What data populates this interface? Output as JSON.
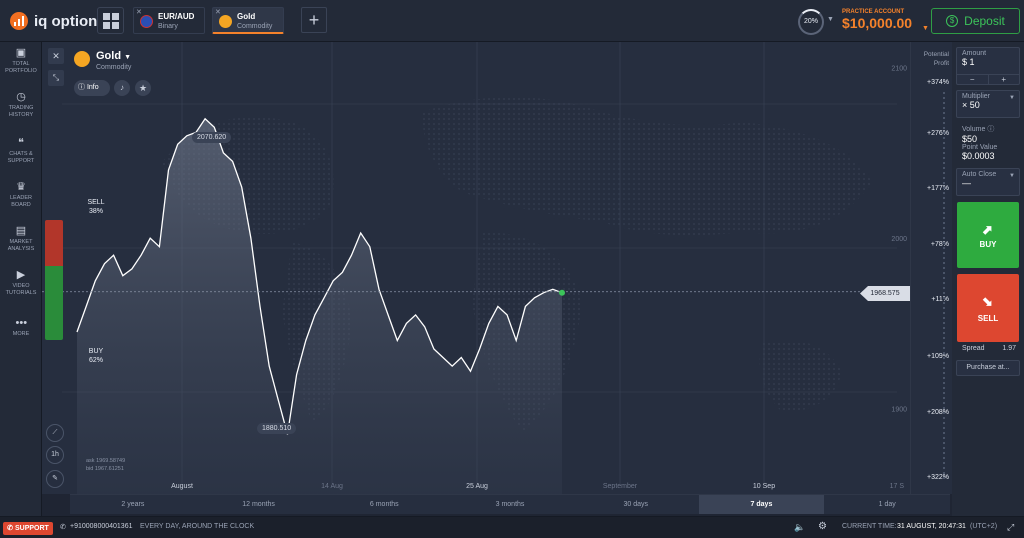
{
  "app": {
    "logo_text": "iq option"
  },
  "tabs": [
    {
      "name": "EUR/AUD",
      "type": "Binary",
      "icon": "eur-aud-flag-icon",
      "active": false
    },
    {
      "name": "Gold",
      "type": "Commodity",
      "icon": "gold-bars-icon",
      "active": true
    }
  ],
  "header": {
    "gauge_value": "20%",
    "account_label": "PRACTICE ACCOUNT",
    "balance": "$10,000.00",
    "deposit_label": "Deposit"
  },
  "sidebar": {
    "items": [
      {
        "label": "TOTAL PORTFOLIO",
        "icon": "briefcase-icon"
      },
      {
        "label": "TRADING HISTORY",
        "icon": "history-icon"
      },
      {
        "label": "CHATS & SUPPORT",
        "icon": "chat-icon"
      },
      {
        "label": "LEADER BOARD",
        "icon": "leaderboard-icon"
      },
      {
        "label": "MARKET ANALYSIS",
        "icon": "analysis-icon"
      },
      {
        "label": "VIDEO TUTORIALS",
        "icon": "play-icon"
      },
      {
        "label": "MORE",
        "icon": "more-icon"
      }
    ]
  },
  "asset": {
    "name": "Gold",
    "type": "Commodity",
    "info_label": "Info"
  },
  "chart": {
    "potential_profit_label": "Potential Profit",
    "current_price": "1968.575",
    "high_label": "2070.620",
    "low_label": "1880.510",
    "price_ticks": [
      "2100",
      "2000",
      "1900"
    ],
    "profit_ticks": [
      "+374%",
      "+276%",
      "+177%",
      "+78%",
      "+11%",
      "+109%",
      "+208%",
      "+322%"
    ],
    "date_ticks": [
      "August",
      "14 Aug",
      "25 Aug",
      "September",
      "10 Sep",
      "17 S"
    ],
    "ask": "ask 1969.58749",
    "bid": "bid 1967.61251",
    "sell_label": "SELL",
    "sell_pct": "38%",
    "buy_label": "BUY",
    "buy_pct": "62%",
    "interval_label": "1h"
  },
  "timeframes": [
    {
      "label": "2 years",
      "active": false
    },
    {
      "label": "12 months",
      "active": false
    },
    {
      "label": "6 months",
      "active": false
    },
    {
      "label": "3 months",
      "active": false
    },
    {
      "label": "30 days",
      "active": false
    },
    {
      "label": "7 days",
      "active": true
    },
    {
      "label": "1 day",
      "active": false
    }
  ],
  "panel": {
    "amount_label": "Amount",
    "amount_value": "$ 1",
    "multiplier_label": "Multiplier",
    "multiplier_value": "× 50",
    "volume_label": "Volume",
    "volume_value": "$50",
    "point_value_label": "Point Value",
    "point_value": "$0.0003",
    "auto_close_label": "Auto Close",
    "auto_close_value": "—",
    "buy_label": "BUY",
    "sell_label": "SELL",
    "spread_label": "Spread",
    "spread_value": "1.97",
    "purchase_label": "Purchase at..."
  },
  "footer": {
    "support_label": "SUPPORT",
    "phone": "+910008000401361",
    "tagline": "EVERY DAY, AROUND THE CLOCK",
    "time_label": "CURRENT TIME:",
    "time_value": "31 AUGUST, 20:47:31",
    "timezone": "(UTC+2)"
  },
  "colors": {
    "buy": "#2eab3f",
    "sell": "#dd4730",
    "accent": "#f5822b",
    "line": "#ffffff"
  },
  "chart_data": {
    "type": "line",
    "series": [
      {
        "values": [
          1945,
          1960,
          1975,
          1985,
          1990,
          1978,
          1982,
          1990,
          2000,
          1995,
          2040,
          2055,
          2060,
          2062,
          2070,
          2065,
          2050,
          2045,
          2030,
          2000,
          1960,
          1925,
          1905,
          1885,
          1920,
          1940,
          1955,
          1965,
          1975,
          1980,
          1990,
          2003,
          1995,
          1970,
          1955,
          1940,
          1950,
          1955,
          1948,
          1935,
          1930,
          1925,
          1930,
          1922,
          1935,
          1950,
          1960,
          1955,
          1940,
          1960,
          1965,
          1968,
          1970,
          1968
        ]
      }
    ],
    "high": 2070.62,
    "low": 1880.51,
    "current": 1968.575,
    "ylim": [
      1850,
      2115
    ]
  }
}
